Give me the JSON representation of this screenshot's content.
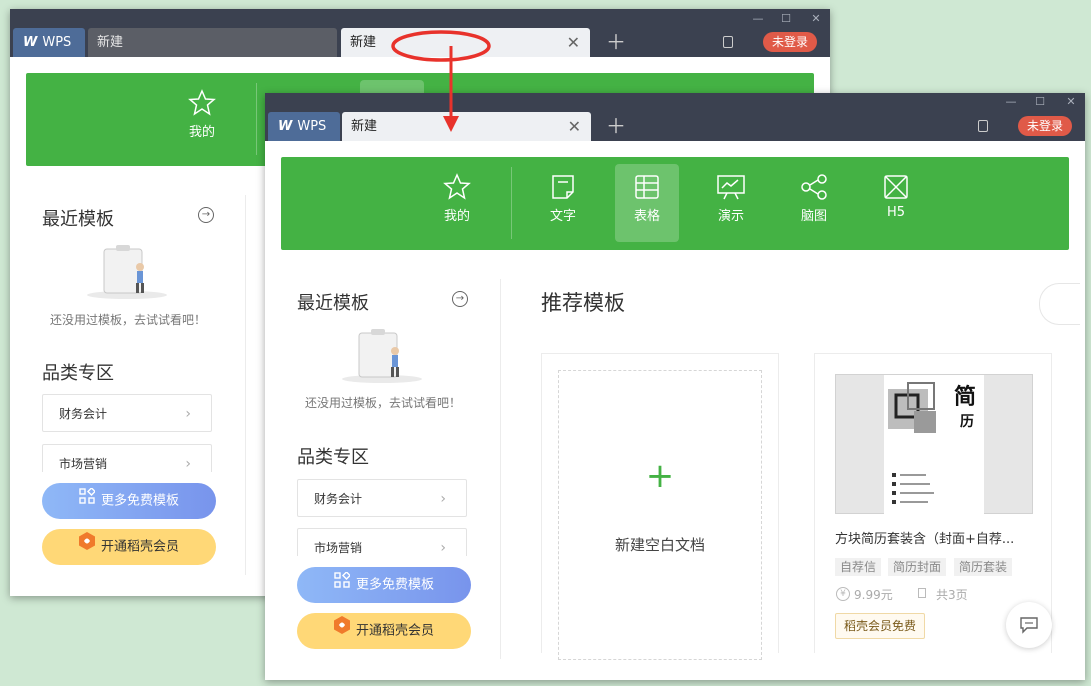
{
  "windows": {
    "back": {
      "tabs": {
        "wps": "WPS",
        "tab1": "新建",
        "tab2": "新建"
      },
      "login": "未登录",
      "toolbar": [
        {
          "label": "我的"
        }
      ],
      "recent_title": "最近模板",
      "empty_text": "还没用过模板，去试试看吧！",
      "category_title": "品类专区",
      "categories": [
        "财务会计",
        "市场营销"
      ],
      "more_templates": "更多免费模板",
      "vip": "开通稻壳会员"
    },
    "front": {
      "tabs": {
        "wps": "WPS",
        "tab1": "新建"
      },
      "login": "未登录",
      "toolbar": [
        {
          "label": "我的",
          "icon": "star-icon"
        },
        {
          "label": "文字",
          "icon": "document-icon"
        },
        {
          "label": "表格",
          "icon": "table-icon"
        },
        {
          "label": "演示",
          "icon": "presentation-icon"
        },
        {
          "label": "脑图",
          "icon": "mindmap-icon"
        },
        {
          "label": "H5",
          "icon": "h5-icon"
        }
      ],
      "active_toolbar": "表格",
      "recent_title": "最近模板",
      "empty_text": "还没用过模板，去试试看吧！",
      "category_title": "品类专区",
      "categories": [
        "财务会计",
        "市场营销"
      ],
      "more_templates": "更多免费模板",
      "vip": "开通稻壳会员",
      "main_title": "推荐模板",
      "new_blank": "新建空白文档",
      "template_card": {
        "title": "方块简历套装含（封面+自荐...",
        "thumb_line1": "简",
        "thumb_line2": "历",
        "tags": [
          "自荐信",
          "简历封面",
          "简历套装"
        ],
        "price": "9.99元",
        "pages": "共3页",
        "vip_free": "稻壳会员免费"
      }
    }
  },
  "colors": {
    "green": "#44b244",
    "titlebar": "#3b4150",
    "annotation": "#e8322b",
    "login": "#e05a48"
  }
}
